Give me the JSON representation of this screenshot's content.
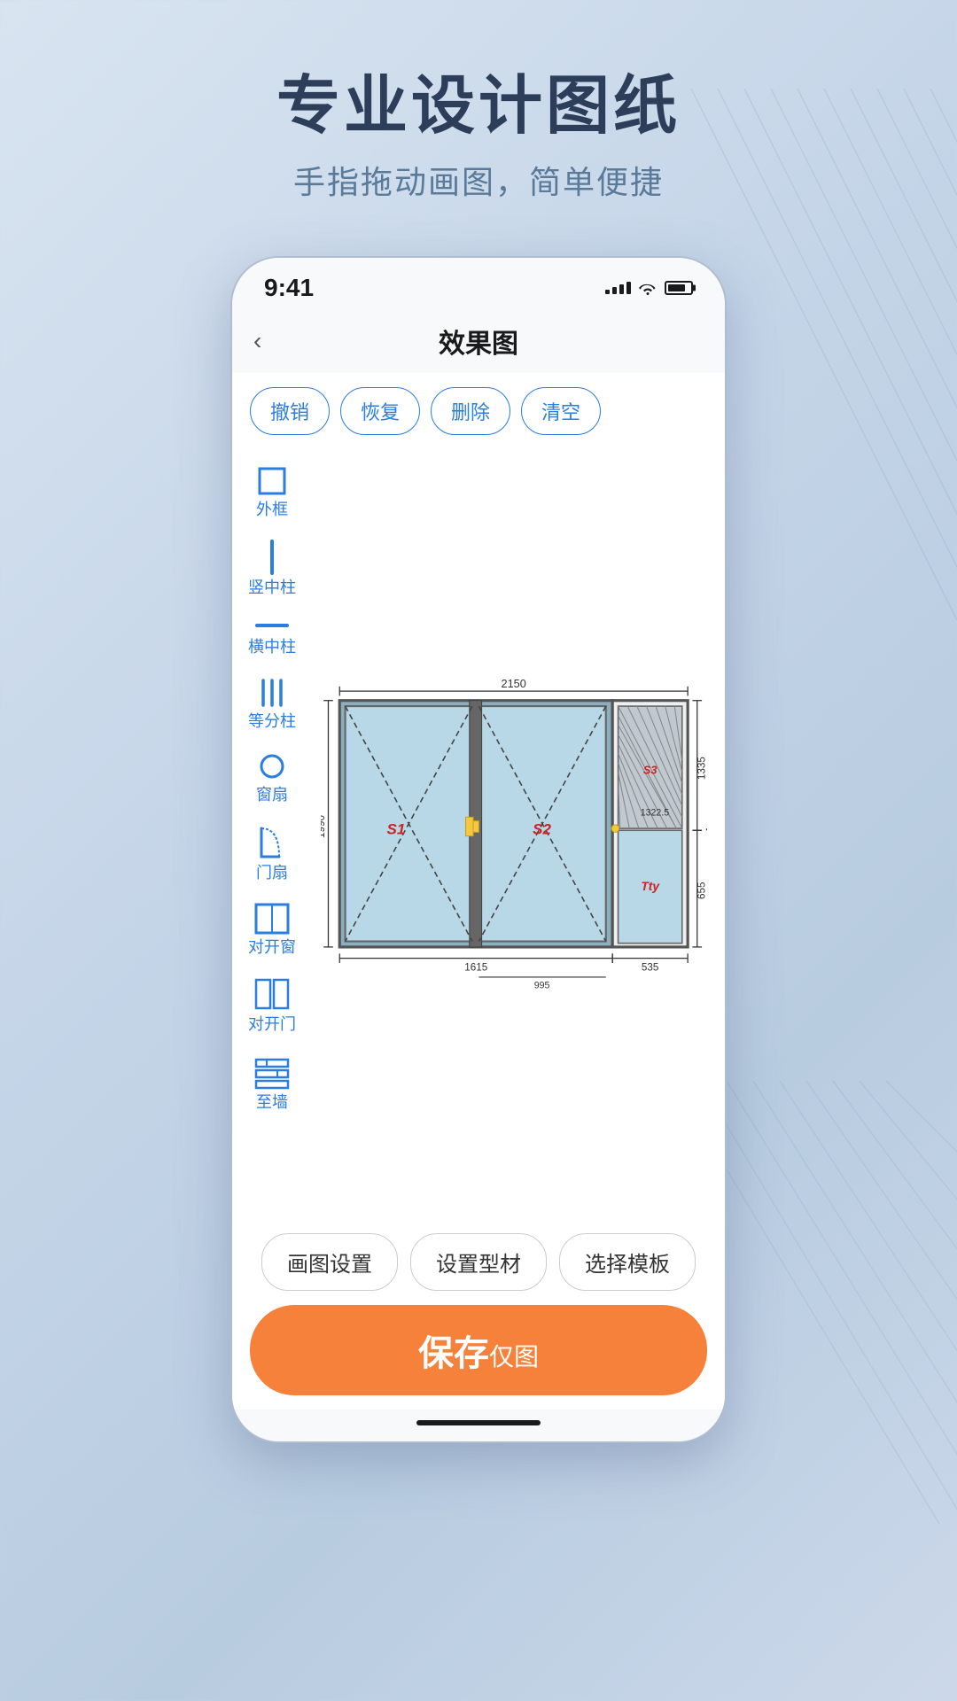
{
  "page": {
    "title": "专业设计图纸",
    "subtitle": "手指拖动画图，简单便捷"
  },
  "status_bar": {
    "time": "9:41"
  },
  "app_header": {
    "title": "效果图",
    "back_label": "‹"
  },
  "toolbar": {
    "undo_label": "撤销",
    "redo_label": "恢复",
    "delete_label": "删除",
    "clear_label": "清空"
  },
  "sidebar": {
    "items": [
      {
        "id": "outer-frame",
        "label": "外框"
      },
      {
        "id": "vertical-pillar",
        "label": "竖中柱"
      },
      {
        "id": "horizontal-pillar",
        "label": "横中柱"
      },
      {
        "id": "equal-pillar",
        "label": "等分柱"
      },
      {
        "id": "window-sash",
        "label": "窗扇"
      },
      {
        "id": "door-sash",
        "label": "门扇"
      },
      {
        "id": "double-window",
        "label": "对开窗"
      },
      {
        "id": "double-door",
        "label": "对开门"
      },
      {
        "id": "wall",
        "label": "至墙"
      }
    ]
  },
  "drawing": {
    "dimensions": {
      "total_width": "2150",
      "height_left": "1990",
      "height_right": "1335",
      "bottom_left": "1615",
      "bottom_right": "535",
      "mid_width": "995",
      "mid_right": "1322.5",
      "bottom_right_small": "655"
    },
    "labels": {
      "s1": "S1",
      "s2": "S2",
      "s3": "S3",
      "tty": "Tty"
    }
  },
  "bottom": {
    "draw_settings": "画图设置",
    "set_profile": "设置型材",
    "choose_template": "选择模板",
    "save_main": "保存",
    "save_sub": "仅图"
  }
}
